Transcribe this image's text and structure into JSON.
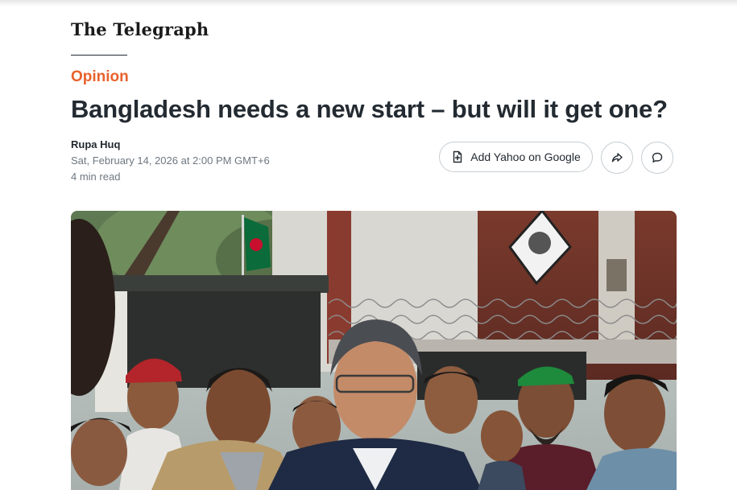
{
  "publisher": {
    "name": "The Telegraph"
  },
  "article": {
    "category": "Opinion",
    "headline": "Bangladesh needs a new start – but will it get one?",
    "author": "Rupa Huq",
    "published": "Sat, February 14, 2026 at 2:00 PM GMT+6",
    "read_time": "4 min read"
  },
  "actions": {
    "add_yahoo_label": "Add Yahoo on Google",
    "add_icon": "add-document-icon",
    "share_icon": "share-arrow-icon",
    "comment_icon": "comment-bubble-icon"
  },
  "hero_image": {
    "subject": "photo"
  },
  "colors": {
    "accent": "#e8622c",
    "text": "#232a31",
    "muted": "#6e7780",
    "border": "#c7cdd2"
  }
}
